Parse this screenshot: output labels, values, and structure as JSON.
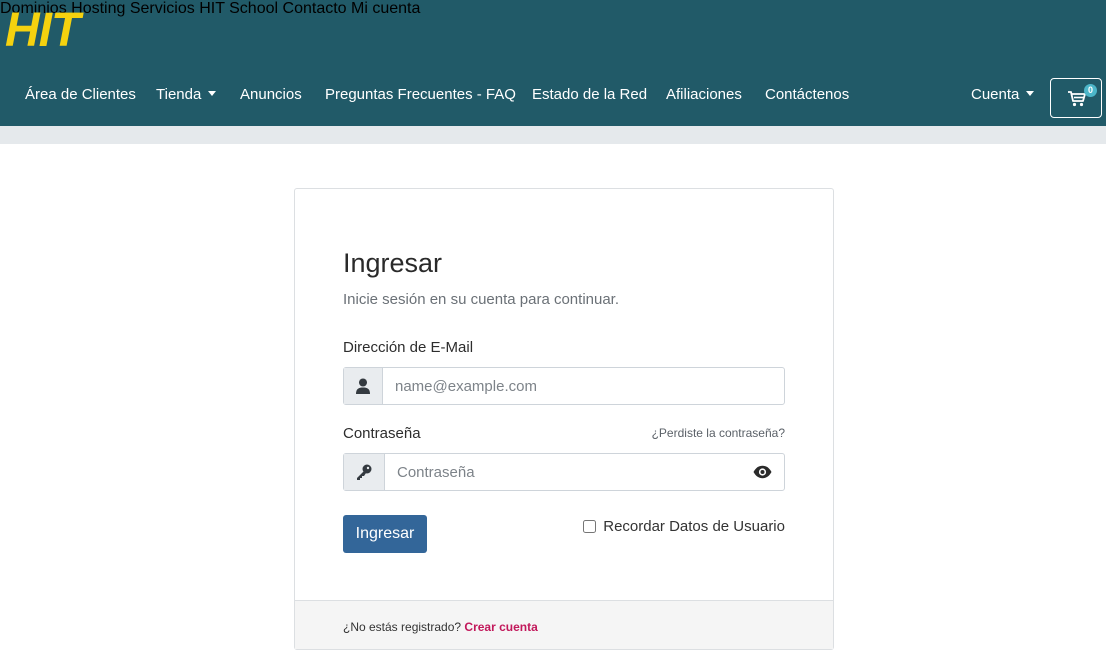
{
  "brand": {
    "logo_text": "HIT",
    "logo_color": "#f5d20f",
    "header_color": "#215a68"
  },
  "top_nav": [
    "Dominios",
    "Hosting",
    "Servicios",
    "HIT School",
    "Contacto",
    "Mi cuenta"
  ],
  "main_nav": {
    "items": [
      "Área de Clientes",
      "Tienda",
      "Anuncios",
      "Preguntas Frecuentes - FAQ",
      "Estado de la Red",
      "Afiliaciones",
      "Contáctenos"
    ],
    "account": "Cuenta",
    "cart_count": "0"
  },
  "login": {
    "title": "Ingresar",
    "subtitle": "Inicie sesión en su cuenta para continuar.",
    "email_label": "Dirección de E-Mail",
    "email_placeholder": "name@example.com",
    "password_label": "Contraseña",
    "forgot_link": "¿Perdiste la contraseña?",
    "password_placeholder": "Contraseña",
    "submit_label": "Ingresar",
    "remember_label": "Recordar Datos de Usuario",
    "register_question": "¿No estás registrado?",
    "register_link": "Crear cuenta"
  }
}
